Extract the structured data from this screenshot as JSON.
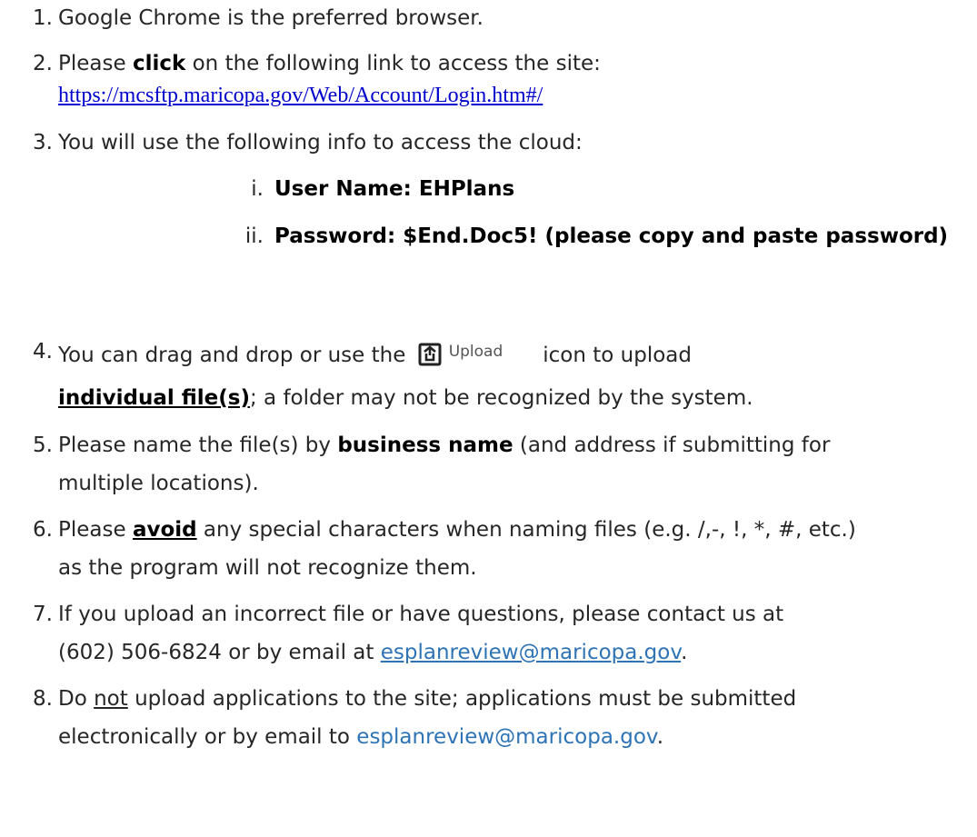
{
  "items": [
    {
      "num": "1.",
      "text": "Google Chrome is the preferred browser."
    },
    {
      "num": "2.",
      "pre": "Please ",
      "bold": "click",
      "post": " on the following link to access the site:",
      "url": "https://mcsftp.maricopa.gov/Web/Account/Login.htm#/"
    },
    {
      "num": "3.",
      "text": "You will use the following info to access the cloud:",
      "sub": [
        {
          "num": "i.",
          "text": "User Name: EHPlans"
        },
        {
          "num": "ii.",
          "text": "Password: $End.Doc5! (please copy and paste password)"
        }
      ]
    },
    {
      "num": "4.",
      "pre": "You can drag and drop or use the ",
      "icon_label": "Upload",
      "post": "icon to upload",
      "bold_ul": "individual file(s)",
      "rest": "; a folder may not be recognized by the system."
    },
    {
      "num": "5.",
      "pre": "Please name the file(s) by ",
      "bold": "business name",
      "post": " (and address if submitting for",
      "line2": "multiple locations)."
    },
    {
      "num": "6.",
      "pre": "Please ",
      "bold_ul": "avoid",
      "post": " any special characters when naming files (e.g. /,-, !, *, #, etc.)",
      "line2": "as the program will not recognize them."
    },
    {
      "num": "7.",
      "text": "If you upload an incorrect file or have questions, please contact us at",
      "pre2": "(602) 506-6824 or by email at ",
      "email": "esplanreview@maricopa.gov",
      "post2": "."
    },
    {
      "num": "8.",
      "pre": "Do ",
      "ul": "not",
      "post": " upload applications to the site; applications must be submitted",
      "pre2": "electronically or by email to ",
      "email": "esplanreview@maricopa.gov",
      "post2": "."
    }
  ],
  "icons": {
    "upload": "upload-icon"
  },
  "colors": {
    "text": "#262626",
    "link": "#0000cc",
    "email": "#2e74b5"
  }
}
